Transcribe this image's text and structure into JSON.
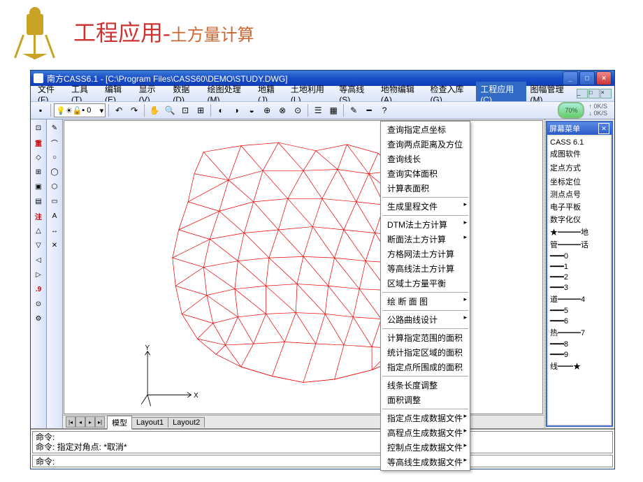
{
  "slide": {
    "title": "工程应用",
    "dash": "-",
    "sub": "土方量计算"
  },
  "titlebar": {
    "text": "南方CASS6.1 - [C:\\Program Files\\CASS60\\DEMO\\STUDY.DWG]"
  },
  "win": {
    "min": "_",
    "max": "□",
    "close": "×"
  },
  "menu": {
    "items": [
      "文件(F)",
      "工具(T)",
      "编辑(E)",
      "显示(V)",
      "数据(D)",
      "绘图处理(M)",
      "地籍(J)",
      "土地利用(L)",
      "等高线(S)",
      "地物编辑(A)",
      "检查入库(G)"
    ],
    "active": "工程应用(C)",
    "after": [
      "图幅管理(M)"
    ]
  },
  "layer": {
    "name": "0"
  },
  "pill": {
    "pct": "70%",
    "l1": "0K/S",
    "l2": "0K/S"
  },
  "dropdown": {
    "g1": [
      "查询指定点坐标",
      "查询两点距离及方位",
      "查询线长",
      "查询实体面积",
      "计算表面积"
    ],
    "g2": [
      "生成里程文件"
    ],
    "g3": [
      "DTM法土方计算",
      "断面法土方计算",
      "方格网法土方计算",
      "等高线法土方计算",
      "区域土方量平衡"
    ],
    "g4": [
      "绘 断 面 图"
    ],
    "g5": [
      "公路曲线设计"
    ],
    "g6": [
      "计算指定范围的面积",
      "统计指定区域的面积",
      "指定点所围成的面积"
    ],
    "g7": [
      "线条长度调整",
      "面积调整"
    ],
    "g8": [
      "指定点生成数据文件",
      "高程点生成数据文件",
      "控制点生成数据文件",
      "等高线生成数据文件"
    ]
  },
  "subs": {
    "g2": [
      0
    ],
    "g3": [
      0,
      1
    ],
    "g4": [
      0
    ],
    "g5": [
      0
    ],
    "g8": [
      0,
      1,
      2,
      3
    ]
  },
  "panel": {
    "title": "屏幕菜单",
    "items": [
      "CASS 6.1",
      "成图软件",
      "",
      "定点方式",
      "",
      "坐标定位",
      "测点点号",
      "电子平板",
      "数字化仪",
      "★━━━地",
      "管━━━话",
      "━━━0",
      "━━━1",
      "━━━2",
      "━━━3",
      "道━━━4",
      "━━━5",
      "━━━6",
      "热━━━7",
      "━━━8",
      "━━━9",
      "线━━★"
    ]
  },
  "tabs": {
    "t1": "模型",
    "t2": "Layout1",
    "t3": "Layout2"
  },
  "cmd": {
    "log1": "命令:",
    "log2": "命令: 指定对角点: *取消*",
    "prompt": "命令:"
  },
  "vtb": [
    "重",
    "",
    "",
    "",
    "",
    "",
    "注",
    "",
    "",
    "",
    "",
    ".9",
    "",
    ""
  ],
  "axis": {
    "x": "X",
    "y": "Y"
  }
}
